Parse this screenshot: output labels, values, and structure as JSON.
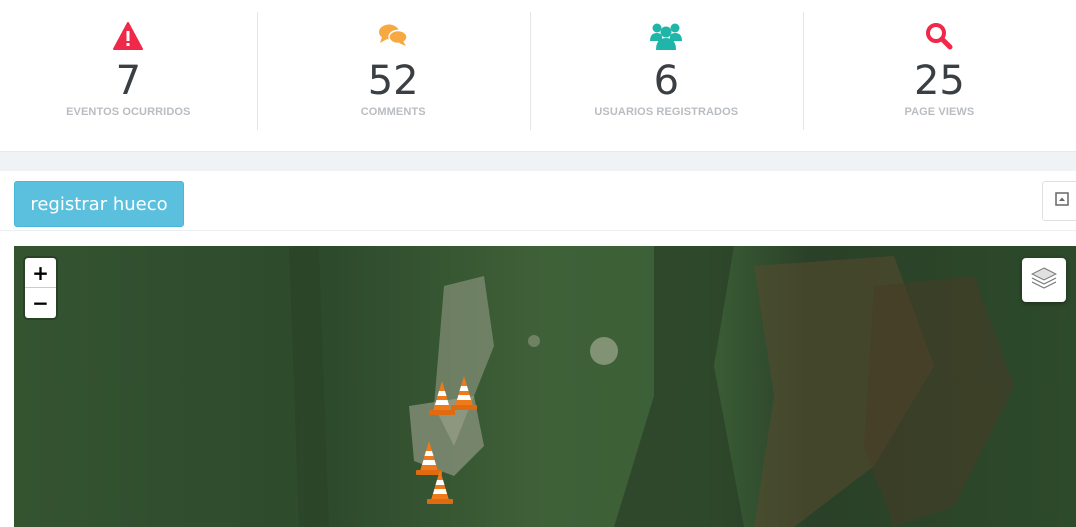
{
  "stats": [
    {
      "value": "7",
      "label": "EVENTOS OCURRIDOS",
      "icon": "warning-icon",
      "color": "#f0284a"
    },
    {
      "value": "52",
      "label": "COMMENTS",
      "icon": "comments-icon",
      "color": "#f5a940"
    },
    {
      "value": "6",
      "label": "USUARIOS REGISTRADOS",
      "icon": "users-icon",
      "color": "#1fb5a8"
    },
    {
      "value": "25",
      "label": "PAGE VIEWS",
      "icon": "search-icon",
      "color": "#f0284a"
    }
  ],
  "panel": {
    "register_label": "registrar hueco",
    "collapse_icon": "collapse-icon"
  },
  "map": {
    "zoom_in": "+",
    "zoom_out": "−",
    "layers_icon": "layers-icon",
    "marker_icon": "traffic-cone-icon",
    "marker_count": 4
  },
  "colors": {
    "info": "#5bc0de",
    "background": "#f0f3f5"
  }
}
